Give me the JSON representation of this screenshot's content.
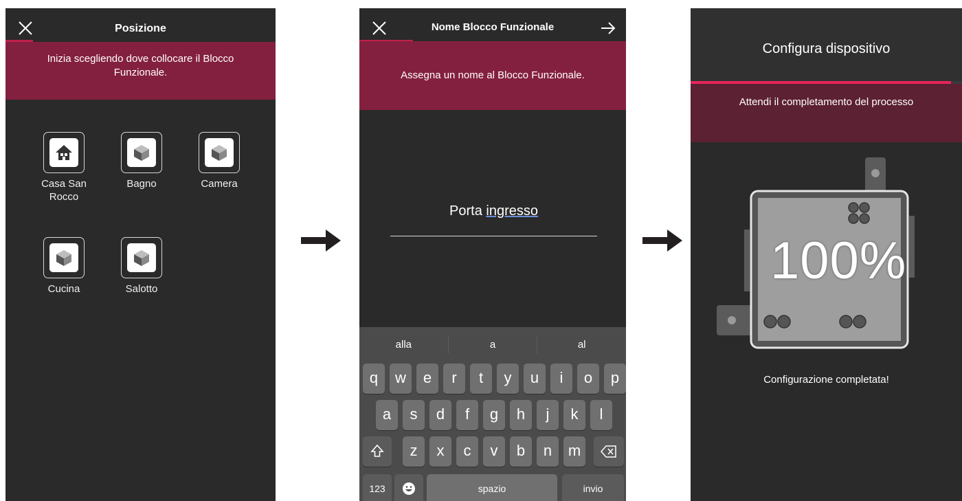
{
  "screen1": {
    "title": "Posizione",
    "banner": "Inizia scegliendo dove collocare il Blocco Funzionale.",
    "rooms": [
      {
        "label": "Casa San Rocco",
        "icon": "house-icon"
      },
      {
        "label": "Bagno",
        "icon": "cube-icon"
      },
      {
        "label": "Camera",
        "icon": "cube-icon"
      },
      {
        "label": "Cucina",
        "icon": "cube-icon"
      },
      {
        "label": "Salotto",
        "icon": "cube-icon"
      }
    ]
  },
  "screen2": {
    "title": "Nome Blocco Funzionale",
    "banner": "Assegna un nome al Blocco Funzionale.",
    "input_value_part1": "Porta ",
    "input_value_part2": "ingresso",
    "suggestions": [
      "alla",
      "a",
      "al"
    ],
    "keys_row1": [
      "q",
      "w",
      "e",
      "r",
      "t",
      "y",
      "u",
      "i",
      "o",
      "p"
    ],
    "keys_row2": [
      "a",
      "s",
      "d",
      "f",
      "g",
      "h",
      "j",
      "k",
      "l"
    ],
    "keys_row3": [
      "z",
      "x",
      "c",
      "v",
      "b",
      "n",
      "m"
    ],
    "numbers_key": "123",
    "space_key": "spazio",
    "return_key": "invio"
  },
  "screen3": {
    "title": "Configura dispositivo",
    "banner": "Attendi il completamento del processo",
    "progress": "100%",
    "progress_fraction": 0.96,
    "status": "Configurazione completata!"
  },
  "colors": {
    "accent": "#c0204a",
    "banner": "#84203f",
    "background": "#2a2a2a"
  }
}
